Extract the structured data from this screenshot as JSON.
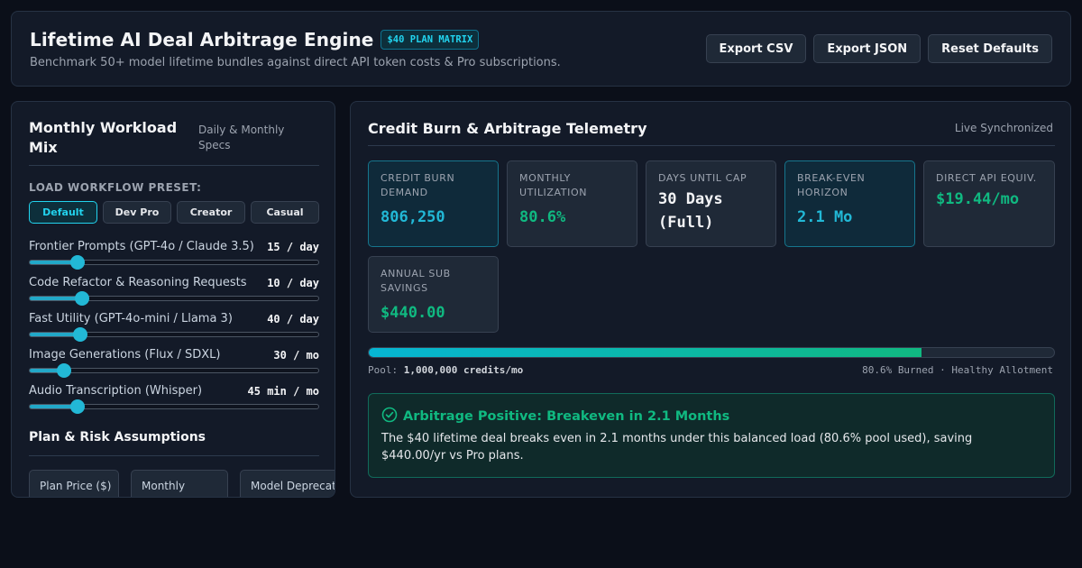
{
  "header": {
    "title": "Lifetime AI Deal Arbitrage Engine",
    "badge": "$40 PLAN MATRIX",
    "subtitle": "Benchmark 50+ model lifetime bundles against direct API token costs & Pro subscriptions.",
    "actions": [
      "Export CSV",
      "Export JSON",
      "Reset Defaults"
    ]
  },
  "workload": {
    "title": "Monthly Workload Mix",
    "spec": "Daily & Monthly Specs",
    "preset_label": "LOAD WORKFLOW PRESET:",
    "presets": [
      {
        "label": "Default",
        "active": true
      },
      {
        "label": "Dev Pro",
        "active": false
      },
      {
        "label": "Creator",
        "active": false
      },
      {
        "label": "Casual",
        "active": false
      }
    ],
    "sliders": [
      {
        "label": "Frontier Prompts (GPT-4o / Claude 3.5)",
        "value": "15 / day",
        "level": 0.165
      },
      {
        "label": "Code Refactor & Reasoning Requests",
        "value": "10 / day",
        "level": 0.18
      },
      {
        "label": "Fast Utility (GPT-4o-mini / Llama 3)",
        "value": "40 / day",
        "level": 0.175
      },
      {
        "label": "Image Generations (Flux / SDXL)",
        "value": "30 / mo",
        "level": 0.12
      },
      {
        "label": "Audio Transcription (Whisper)",
        "value": "45 min / mo",
        "level": 0.165
      }
    ],
    "assumptions_title": "Plan & Risk Assumptions",
    "assumptions": [
      "Plan Price ($)",
      "Monthly",
      "Model Deprecation"
    ]
  },
  "telemetry": {
    "title": "Credit Burn & Arbitrage Telemetry",
    "status": "Live Synchronized",
    "cards": [
      {
        "label": "CREDIT BURN DEMAND",
        "value": "806,250",
        "color": "#22b8d6",
        "highlight": true
      },
      {
        "label": "MONTHLY UTILIZATION",
        "value": "80.6%",
        "color": "#10b981",
        "highlight": false
      },
      {
        "label": "DAYS UNTIL CAP",
        "value": "30 Days (Full)",
        "color": "#f3f4f6",
        "highlight": false
      },
      {
        "label": "BREAK-EVEN HORIZON",
        "value": "2.1 Mo",
        "color": "#22b8d6",
        "highlight": true
      },
      {
        "label": "DIRECT API EQUIV.",
        "value": "$19.44/mo",
        "color": "#10b981",
        "highlight": false
      },
      {
        "label": "ANNUAL SUB SAVINGS",
        "value": "$440.00",
        "color": "#10b981",
        "highlight": false
      }
    ],
    "pool": {
      "label": "Pool:",
      "amount": "1,000,000 credits/mo",
      "status": "80.6% Burned · Healthy Allotment",
      "fraction": 0.806
    },
    "verdict": {
      "title": "Arbitrage Positive: Breakeven in 2.1 Months",
      "body": "The $40 lifetime deal breaks even in 2.1 months under this balanced load (80.6% pool used), saving $440.00/yr vs Pro plans."
    }
  }
}
